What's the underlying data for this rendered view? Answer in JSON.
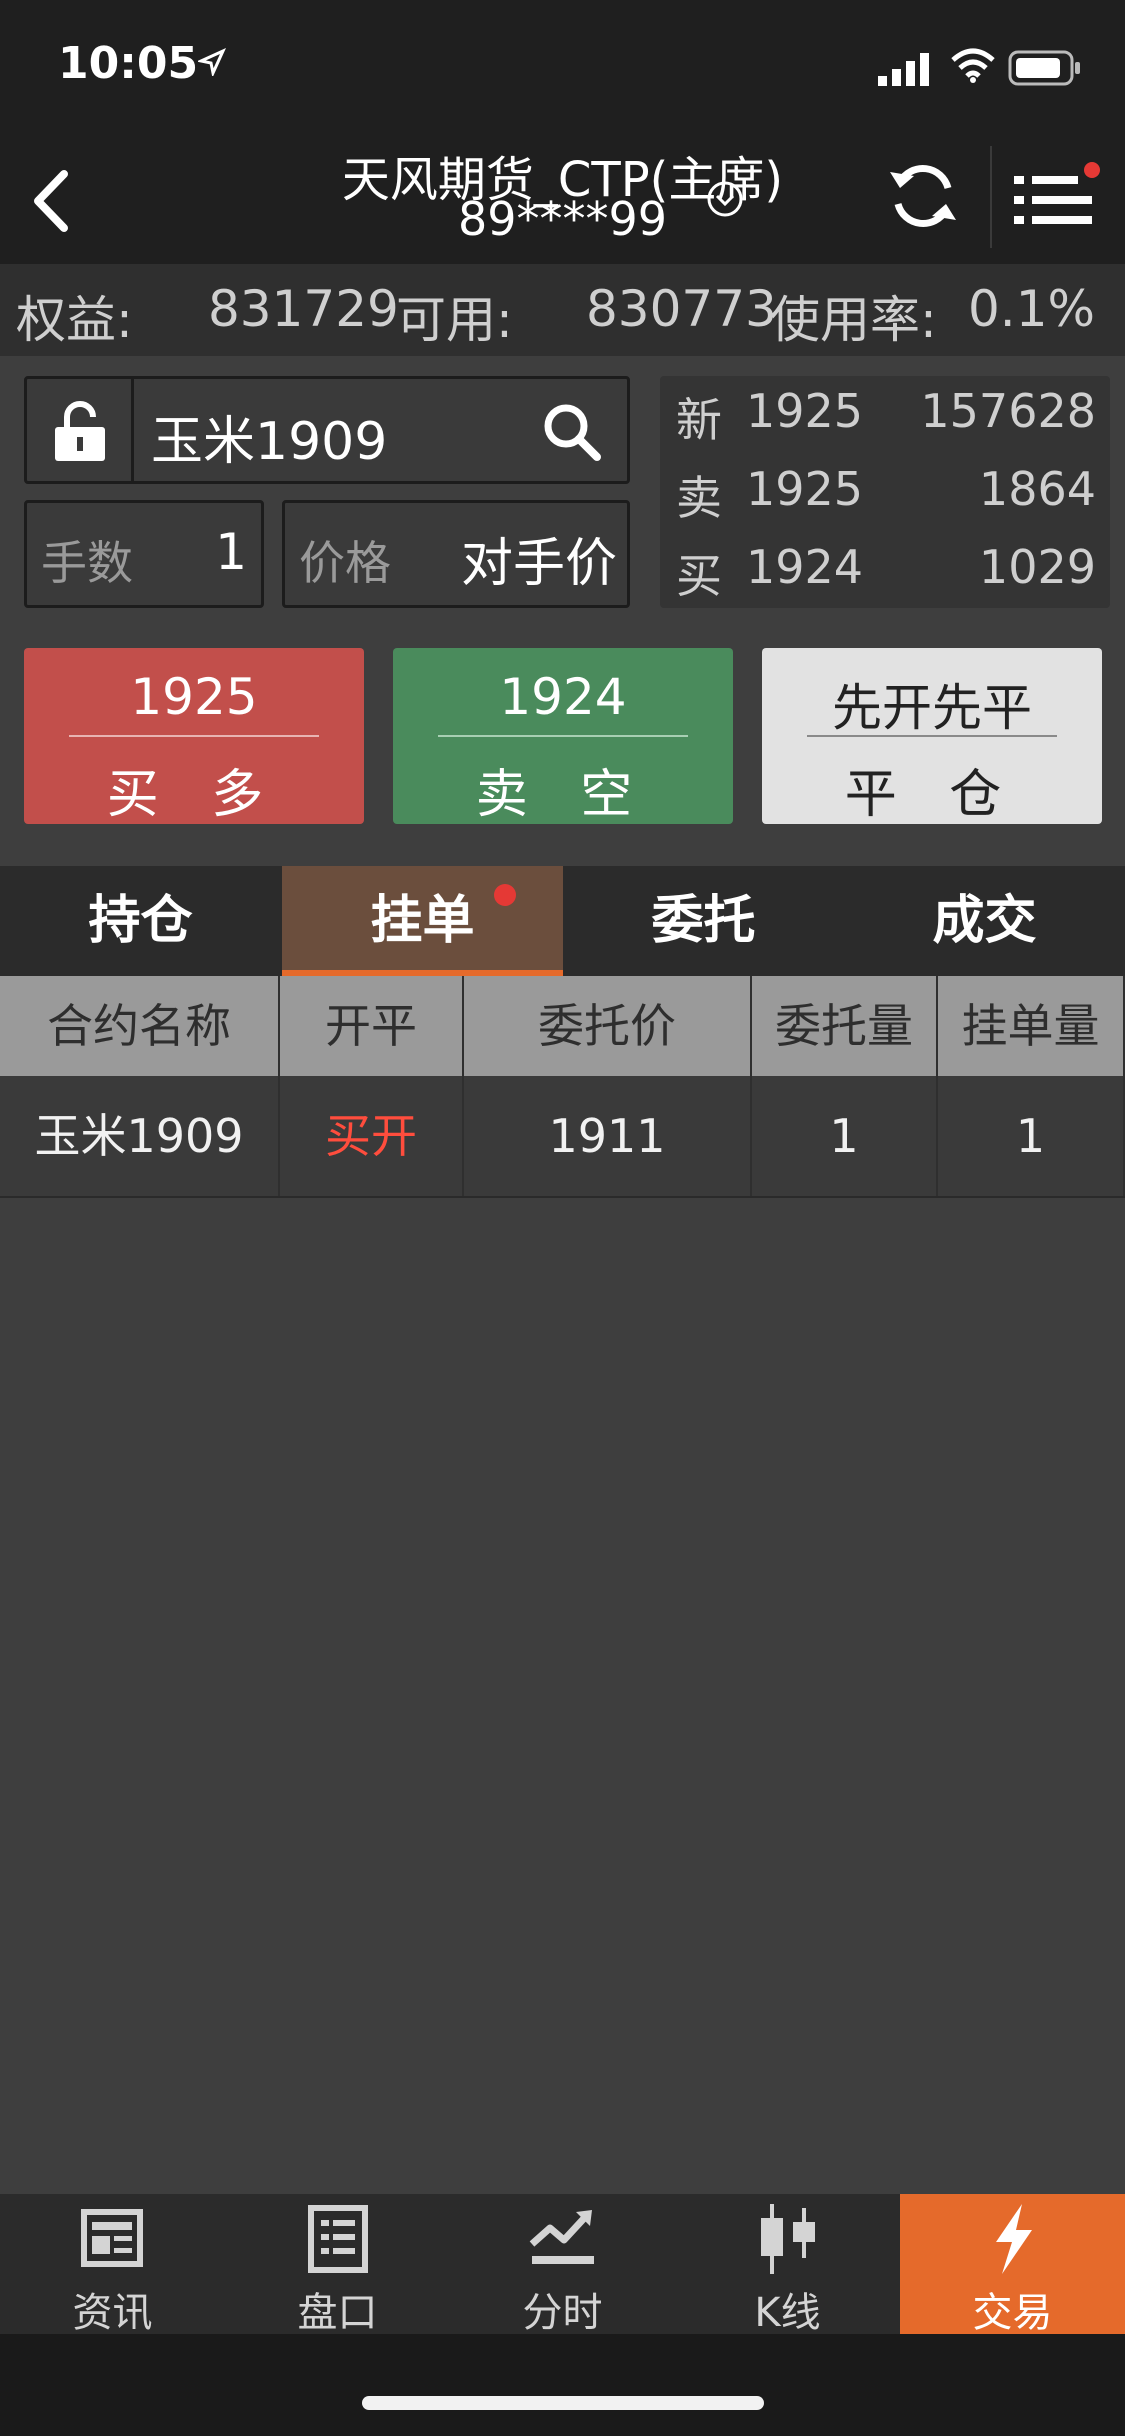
{
  "status": {
    "time": "10:05"
  },
  "header": {
    "title": "天风期货_CTP(主席)",
    "account": "89****99"
  },
  "account_bar": {
    "equity_label": "权益:",
    "equity_value": "831729",
    "available_label": "可用:",
    "available_value": "830773",
    "usage_label": "使用率:",
    "usage_value": "0.1%"
  },
  "order_panel": {
    "contract": "玉米1909",
    "lots_label": "手数",
    "lots_value": "1",
    "price_label": "价格",
    "price_value": "对手价",
    "quote": [
      {
        "label": "新",
        "price": "1925",
        "volume": "157628"
      },
      {
        "label": "卖",
        "price": "1925",
        "volume": "1864"
      },
      {
        "label": "买",
        "price": "1924",
        "volume": "1029"
      }
    ]
  },
  "buttons": {
    "buy": {
      "price": "1925",
      "label": "买 多"
    },
    "sell": {
      "price": "1924",
      "label": "卖 空"
    },
    "close": {
      "top": "先开先平",
      "label": "平 仓"
    }
  },
  "tabs": [
    "持仓",
    "挂单",
    "委托",
    "成交"
  ],
  "active_tab": "挂单",
  "table": {
    "headers": [
      "合约名称",
      "开平",
      "委托价",
      "委托量",
      "挂单量"
    ],
    "rows": [
      [
        "玉米1909",
        "买开",
        "1911",
        "1",
        "1"
      ]
    ]
  },
  "bottom_nav": [
    "资讯",
    "盘口",
    "分时",
    "K线",
    "交易"
  ],
  "colors": {
    "buy": "#c24f4b",
    "sell": "#4a8b5c",
    "close": "#e2e2e2",
    "accent": "#e56a2b",
    "badge": "#e53935"
  }
}
